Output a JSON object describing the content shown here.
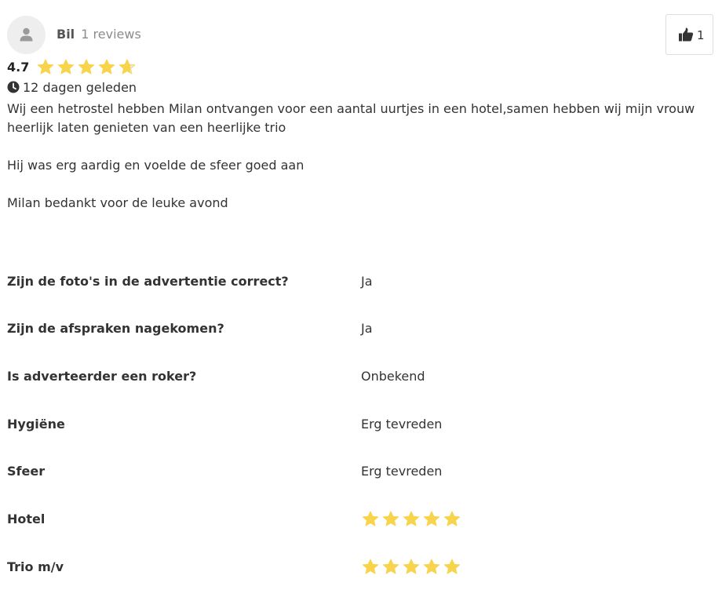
{
  "reviewer": {
    "name": "Bil",
    "reviews_count": "1 reviews",
    "avatar_icon": "user-icon"
  },
  "like": {
    "icon": "thumbs-up-icon",
    "count": "1"
  },
  "rating": {
    "score": "4.7",
    "stars_value": 4.7,
    "stars_max": 5
  },
  "time": {
    "icon": "clock-icon",
    "text": "12 dagen geleden"
  },
  "body": {
    "paragraph_1": "Wij een hetrostel hebben Milan ontvangen voor een aantal uurtjes in een hotel,samen hebben wij mijn vrouw heerlijk laten genieten van een heerlijke trio",
    "paragraph_2": "Hij was erg aardig en voelde de sfeer goed aan",
    "paragraph_3": "Milan bedankt voor de leuke avond"
  },
  "questions": [
    {
      "label": "Zijn de foto's in de advertentie correct?",
      "value": "Ja"
    },
    {
      "label": "Zijn de afspraken nagekomen?",
      "value": "Ja"
    },
    {
      "label": "Is adverteerder een roker?",
      "value": "Onbekend"
    },
    {
      "label": "Hygiëne",
      "value": "Erg tevreden"
    },
    {
      "label": "Sfeer",
      "value": "Erg tevreden"
    },
    {
      "label": "Hotel",
      "stars": 5
    },
    {
      "label": "Trio m/v",
      "stars": 5
    }
  ],
  "colors": {
    "star": "#f7d44c",
    "star_empty": "#e6e6e6",
    "text": "#333333",
    "muted": "#8c8c8c"
  }
}
